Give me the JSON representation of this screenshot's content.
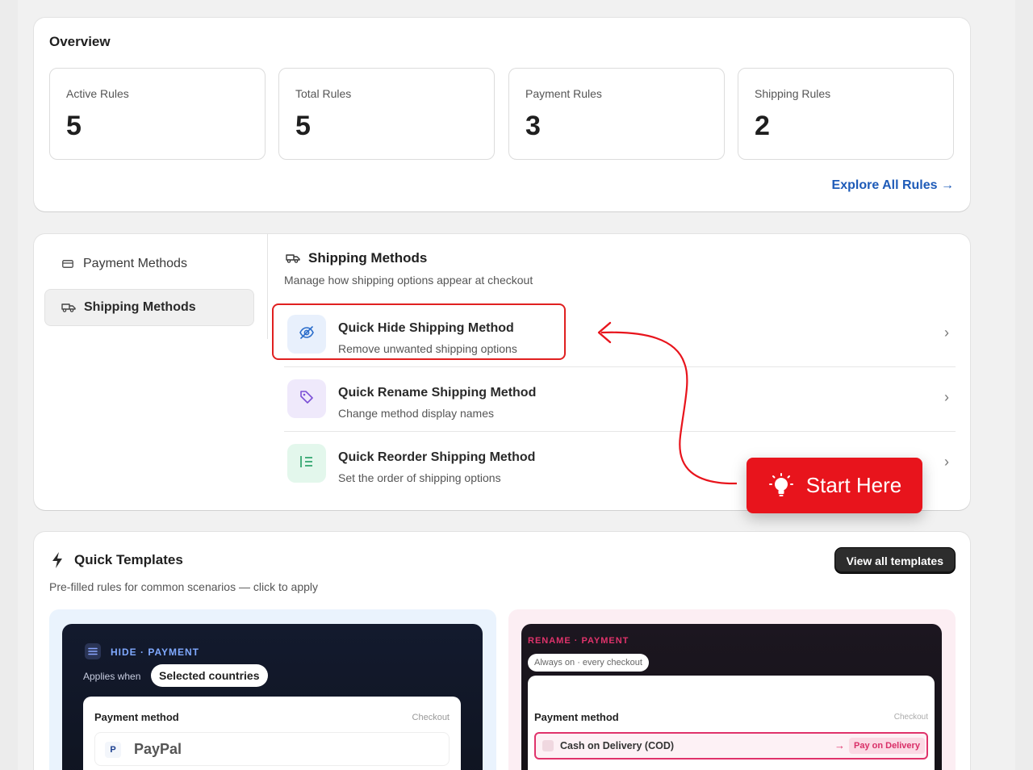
{
  "overview": {
    "title": "Overview",
    "stats": [
      {
        "label": "Active Rules",
        "value": "5"
      },
      {
        "label": "Total Rules",
        "value": "5"
      },
      {
        "label": "Payment Rules",
        "value": "3"
      },
      {
        "label": "Shipping Rules",
        "value": "2"
      }
    ],
    "explore_link": "Explore All Rules →"
  },
  "sidebar": {
    "items": [
      {
        "label": "Payment Methods",
        "icon": "credit-card-icon",
        "active": false
      },
      {
        "label": "Shipping Methods",
        "icon": "truck-icon",
        "active": true
      }
    ]
  },
  "shipping": {
    "title": "Shipping Methods",
    "subtitle": "Manage how shipping options appear at checkout",
    "options": [
      {
        "title": "Quick Hide Shipping Method",
        "subtitle": "Remove unwanted shipping options",
        "icon": "eye-slash-icon",
        "accent": "#2c6ecb",
        "bg": "#e8f0fc"
      },
      {
        "title": "Quick Rename Shipping Method",
        "subtitle": "Change method display names",
        "icon": "tag-icon",
        "accent": "#7b4fd6",
        "bg": "#efe9fb"
      },
      {
        "title": "Quick Reorder Shipping Method",
        "subtitle": "Set the order of shipping options",
        "icon": "list-order-icon",
        "accent": "#1f9d62",
        "bg": "#e3f7ec"
      }
    ]
  },
  "callout": {
    "label": "Start Here",
    "color": "#e8141c"
  },
  "templates": {
    "title": "Quick Templates",
    "subtitle": "Pre-filled rules for common scenarios — click to apply",
    "view_all": "View all templates",
    "cards": [
      {
        "tag": "HIDE · PAYMENT",
        "applies_label": "Applies when",
        "applies_value": "Selected countries",
        "panel_title": "Payment method",
        "panel_meta": "Checkout",
        "method": "PayPal"
      },
      {
        "tag": "RENAME · PAYMENT",
        "applies_value": "Always on · every checkout",
        "panel_title": "Payment method",
        "panel_meta": "Checkout",
        "method": "Cash on Delivery (COD)",
        "arrow": "→",
        "renamed": "Pay on Delivery"
      }
    ]
  }
}
